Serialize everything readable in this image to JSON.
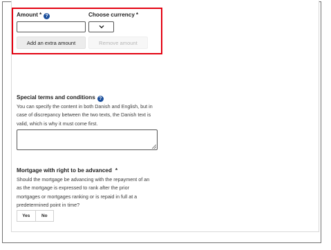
{
  "amount_section": {
    "amount_label": "Amount",
    "required_mark": "*",
    "currency_label": "Choose currency",
    "currency_required_mark": "*",
    "currency_value": "",
    "amount_value": "",
    "add_extra_amount_label": "Add an extra amount",
    "remove_amount_label": "Remove amount"
  },
  "special_terms": {
    "label": "Special terms and conditions",
    "help_line_1": "You can specify the content in both Danish and English, but in",
    "help_line_2": "case of discrepancy between the two texts, the Danish text is",
    "help_line_3": "valid, which is why it must come first.",
    "value": ""
  },
  "mortgage_advance": {
    "label": "Mortgage with right to be advanced",
    "required_mark": "*",
    "help_line_1": "Should the mortgage be advancing with the repayment of an",
    "help_line_2": "as the mortgage is expressed to rank after the prior",
    "help_line_3": "mortgages or mortgages ranking or is repaid in full at a",
    "help_line_4": "predetermined point in time?",
    "yes_label": "Yes",
    "no_label": "No"
  },
  "colors": {
    "highlight_border": "#e3000f",
    "help_icon": "#1b4f9c",
    "disabled_text": "#b5b5b5"
  },
  "icons": {
    "help": "question-circle-icon",
    "select_arrow": "chevron-down-icon"
  }
}
